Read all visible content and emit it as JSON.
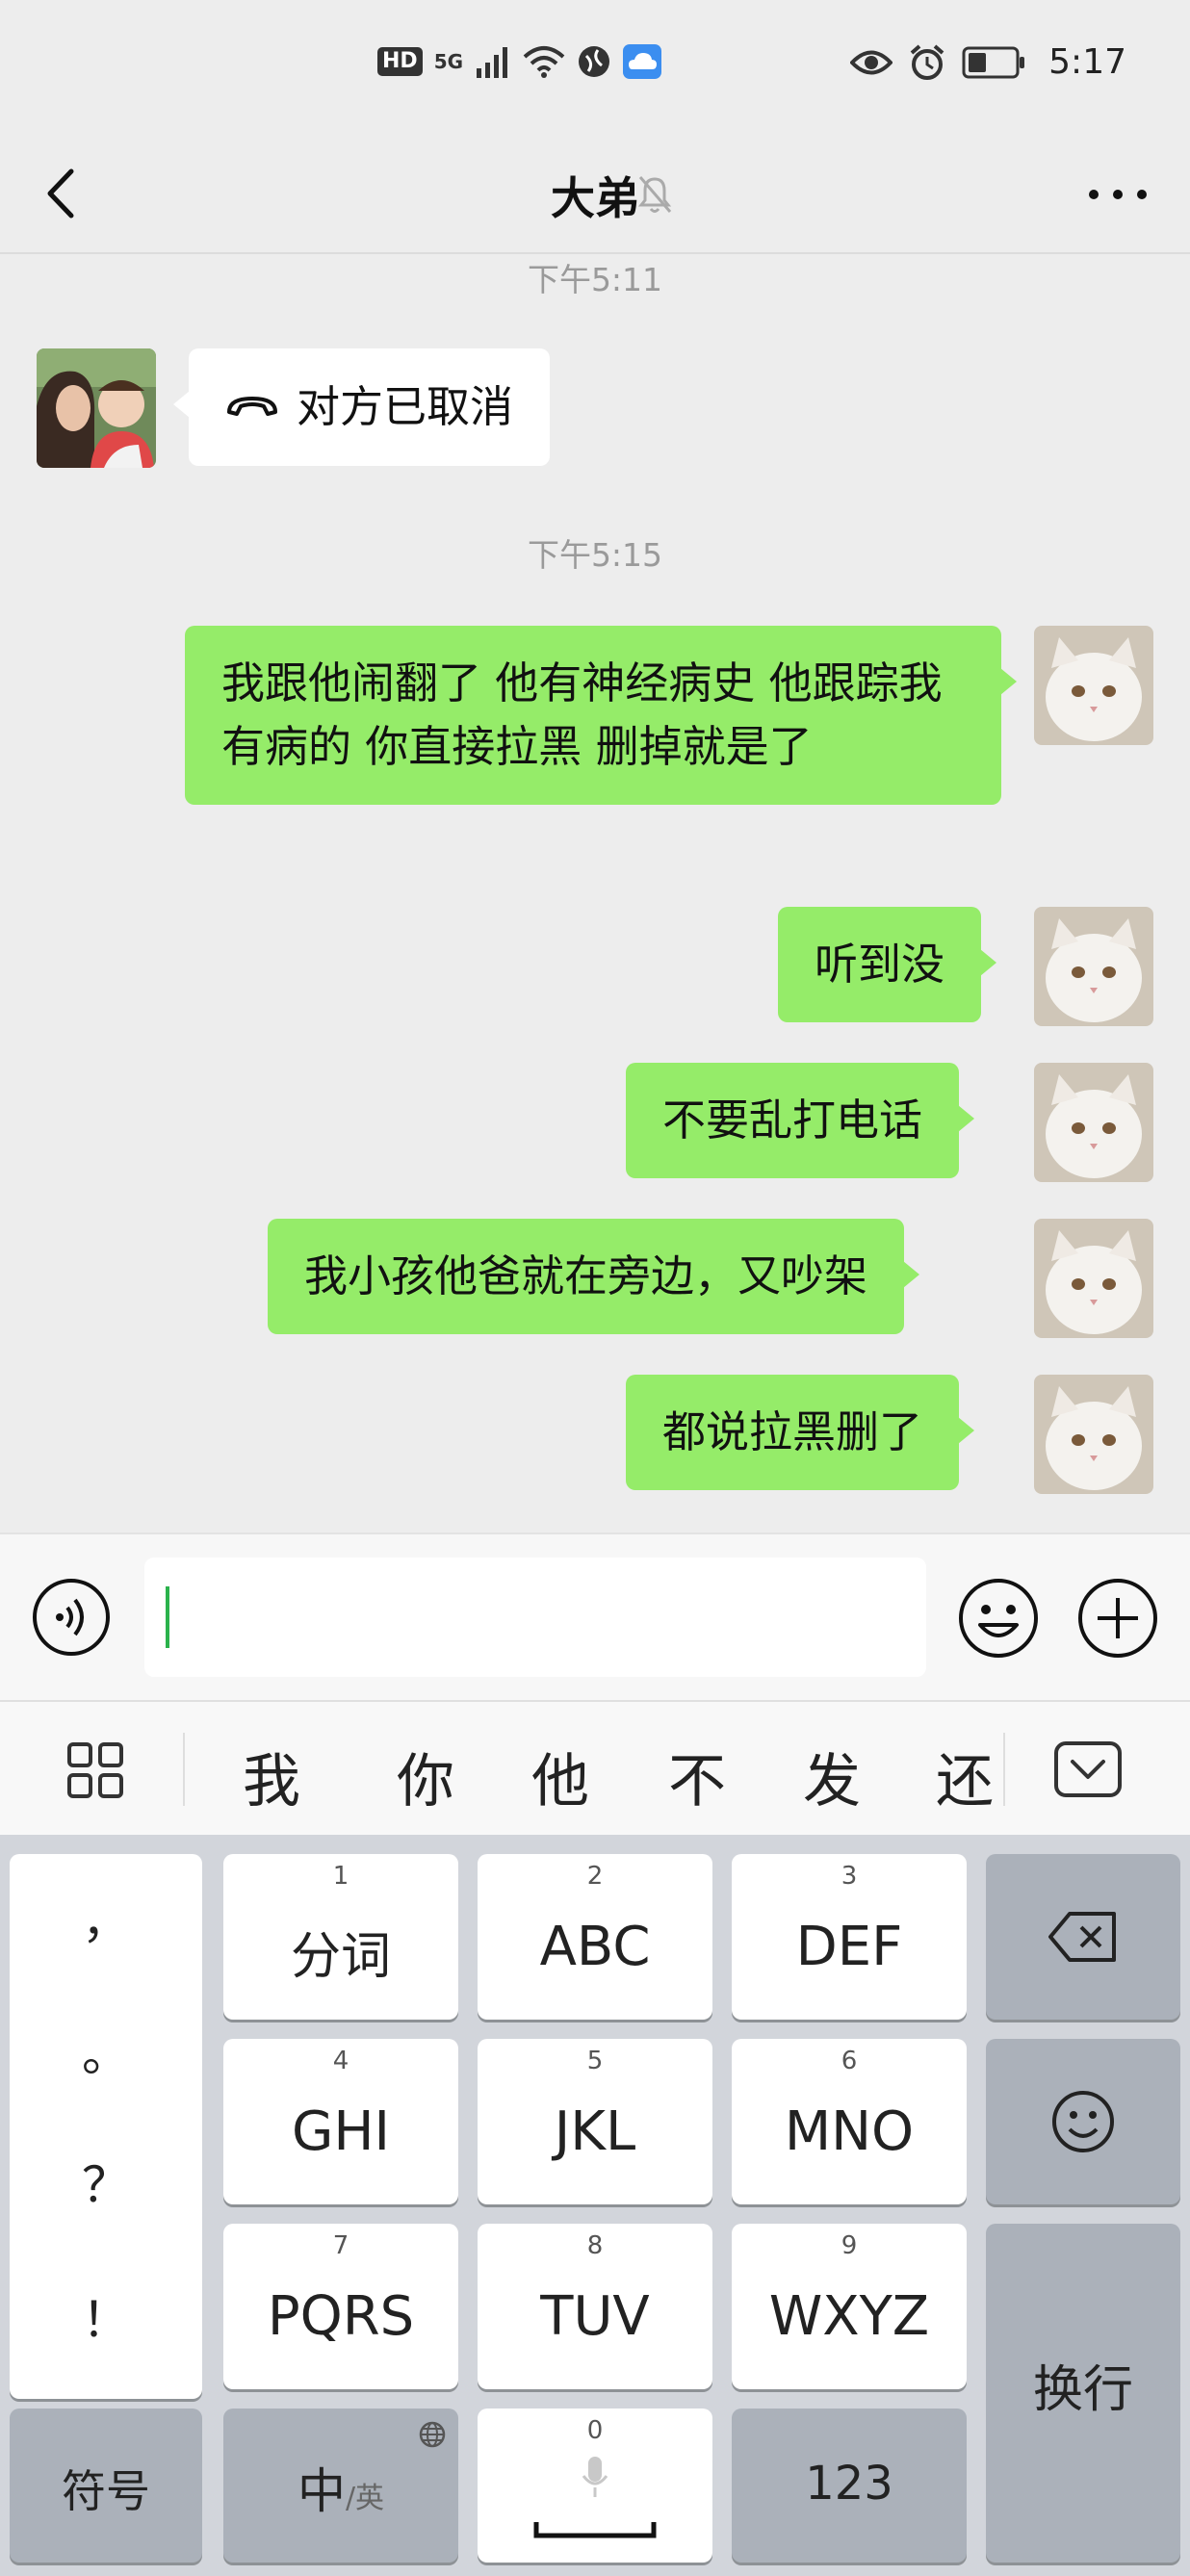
{
  "status_bar": {
    "hd_badge": "HD",
    "network": "5G",
    "time": "5:17",
    "icons": [
      "signal-icon",
      "wifi-icon",
      "vpn-icon",
      "cloud-icon",
      "eye-icon",
      "alarm-icon",
      "battery-icon"
    ]
  },
  "nav": {
    "title": "大弟",
    "icons": [
      "back-icon",
      "mute-bell-icon",
      "more-icon"
    ]
  },
  "messages": {
    "ts1": "下午5:11",
    "call_text": "对方已取消",
    "ts2": "下午5:15",
    "m1": "我跟他闹翻了 他有神经病史 他跟踪我 有病的 你直接拉黑 删掉就是了",
    "m2": "听到没",
    "m3": "不要乱打电话",
    "m4": "我小孩他爸就在旁边，又吵架",
    "m5": "都说拉黑删了"
  },
  "input": {
    "value": "",
    "icons": [
      "voice-icon",
      "emoji-icon",
      "plus-icon"
    ]
  },
  "candidates": {
    "items": [
      "我",
      "你",
      "他",
      "不",
      "发",
      "还"
    ],
    "icons": [
      "grid-icon",
      "hide-keyboard-icon"
    ]
  },
  "keyboard": {
    "punct": [
      "，",
      "。",
      "？",
      "！"
    ],
    "k1_num": "1",
    "k1": "分词",
    "k2_num": "2",
    "k2": "ABC",
    "k3_num": "3",
    "k3": "DEF",
    "k4_num": "4",
    "k4": "GHI",
    "k5_num": "5",
    "k5": "JKL",
    "k6_num": "6",
    "k6": "MNO",
    "k7_num": "7",
    "k7": "PQRS",
    "k8_num": "8",
    "k8": "TUV",
    "k9_num": "9",
    "k9": "WXYZ",
    "k0_num": "0",
    "symbols": "符号",
    "lang_main": "中",
    "lang_sub": "/英",
    "numbers": "123",
    "enter": "换行",
    "icons": [
      "backspace-icon",
      "smiley-icon",
      "mic-icon",
      "space-icon",
      "globe-icon"
    ]
  },
  "colors": {
    "my_bubble": "#95ec69",
    "their_bubble": "#ffffff",
    "background": "#ededed",
    "caret": "#2bb24c"
  }
}
